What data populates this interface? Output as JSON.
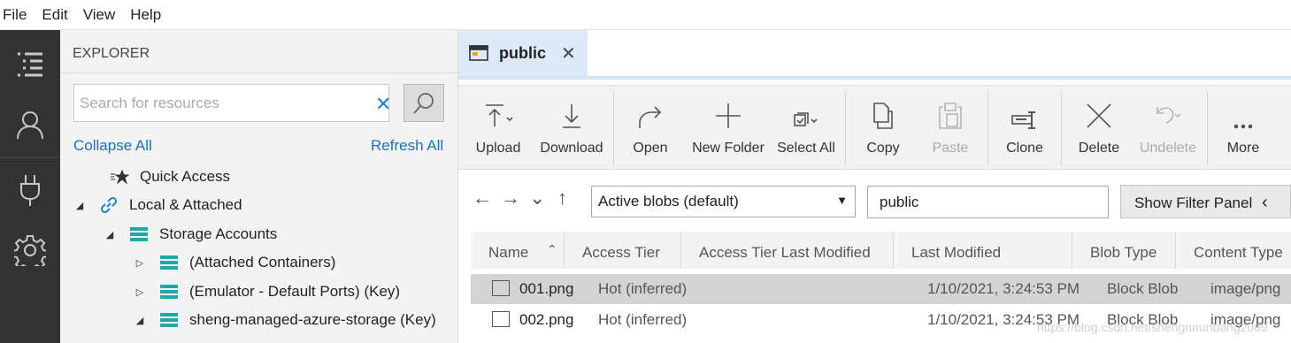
{
  "menu": [
    "File",
    "Edit",
    "View",
    "Help"
  ],
  "activity_bar": {
    "items": [
      {
        "icon": "explorer-icon"
      },
      {
        "icon": "account-icon"
      },
      {
        "icon": "plug-icon"
      },
      {
        "icon": "gear-icon"
      }
    ]
  },
  "explorer": {
    "title": "EXPLORER",
    "search_placeholder": "Search for resources",
    "collapse_all": "Collapse All",
    "refresh_all": "Refresh All",
    "tree": [
      {
        "label": "Quick Access",
        "icon": "quick-access-icon",
        "twisty": ""
      },
      {
        "label": "Local & Attached",
        "icon": "link-icon",
        "twisty": "◢"
      },
      {
        "label": "Storage Accounts",
        "icon": "storage-icon",
        "twisty": "◢"
      },
      {
        "label": "(Attached Containers)",
        "icon": "storage-icon",
        "twisty": "▷"
      },
      {
        "label": "(Emulator - Default Ports) (Key)",
        "icon": "storage-icon",
        "twisty": "▷"
      },
      {
        "label": "sheng-managed-azure-storage (Key)",
        "icon": "storage-icon",
        "twisty": "◢"
      }
    ]
  },
  "tab": {
    "label": "public",
    "close": "✕",
    "icon": "container-icon"
  },
  "toolbar": {
    "buttons": [
      {
        "label": "Upload",
        "icon": "upload-icon",
        "enabled": true
      },
      {
        "label": "Download",
        "icon": "download-icon",
        "enabled": true
      },
      {
        "label": "Open",
        "icon": "open-icon",
        "enabled": true
      },
      {
        "label": "New Folder",
        "icon": "plus-icon",
        "enabled": true
      },
      {
        "label": "Select All",
        "icon": "select-all-icon",
        "enabled": true
      },
      {
        "label": "Copy",
        "icon": "copy-icon",
        "enabled": true
      },
      {
        "label": "Paste",
        "icon": "paste-icon",
        "enabled": false
      },
      {
        "label": "Clone",
        "icon": "clone-icon",
        "enabled": true
      },
      {
        "label": "Delete",
        "icon": "delete-icon",
        "enabled": true
      },
      {
        "label": "Undelete",
        "icon": "undelete-icon",
        "enabled": false
      },
      {
        "label": "More",
        "icon": "more-icon",
        "enabled": true
      }
    ]
  },
  "nav": {
    "blob_filter": "Active blobs (default)",
    "path": "public",
    "filter_button": "Show Filter Panel"
  },
  "grid": {
    "columns": [
      "Name",
      "Access Tier",
      "Access Tier Last Modified",
      "Last Modified",
      "Blob Type",
      "Content Type"
    ],
    "rows": [
      {
        "name": "001.png",
        "tier": "Hot (inferred)",
        "last_modified": "1/10/2021, 3:24:53 PM",
        "blob_type": "Block Blob",
        "content_type": "image/png",
        "selected": true
      },
      {
        "name": "002.png",
        "tier": "Hot (inferred)",
        "last_modified": "1/10/2021, 3:24:53 PM",
        "blob_type": "Block Blob",
        "content_type": "image/png",
        "selected": false
      }
    ]
  },
  "watermark": "https://blog.csdn.net/shengnnunbang2009"
}
